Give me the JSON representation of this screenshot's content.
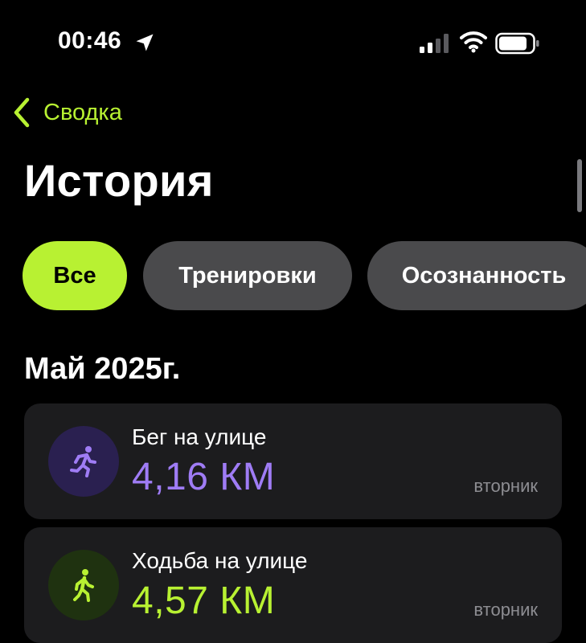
{
  "status_bar": {
    "time": "00:46",
    "icons": [
      "location-arrow-icon",
      "cellular-signal-icon",
      "wifi-icon",
      "battery-icon"
    ]
  },
  "nav": {
    "back_label": "Сводка"
  },
  "page": {
    "title": "История"
  },
  "filters": [
    {
      "label": "Все",
      "selected": true
    },
    {
      "label": "Тренировки",
      "selected": false
    },
    {
      "label": "Осознанность",
      "selected": false
    }
  ],
  "section": {
    "title": "Май 2025г."
  },
  "activities": [
    {
      "type": "Бег на улице",
      "value": "4,16 КМ",
      "day": "вторник",
      "icon": "running-figure-icon",
      "accent": "#9f7cf5"
    },
    {
      "type": "Ходьба на улице",
      "value": "4,57 КМ",
      "day": "вторник",
      "icon": "walking-figure-icon",
      "accent": "#b8f132"
    }
  ],
  "colors": {
    "accent_green": "#b8f132",
    "accent_purple": "#9f7cf5",
    "background": "#000000",
    "card": "#1c1c1e",
    "chip_inactive": "#4a4a4c"
  }
}
